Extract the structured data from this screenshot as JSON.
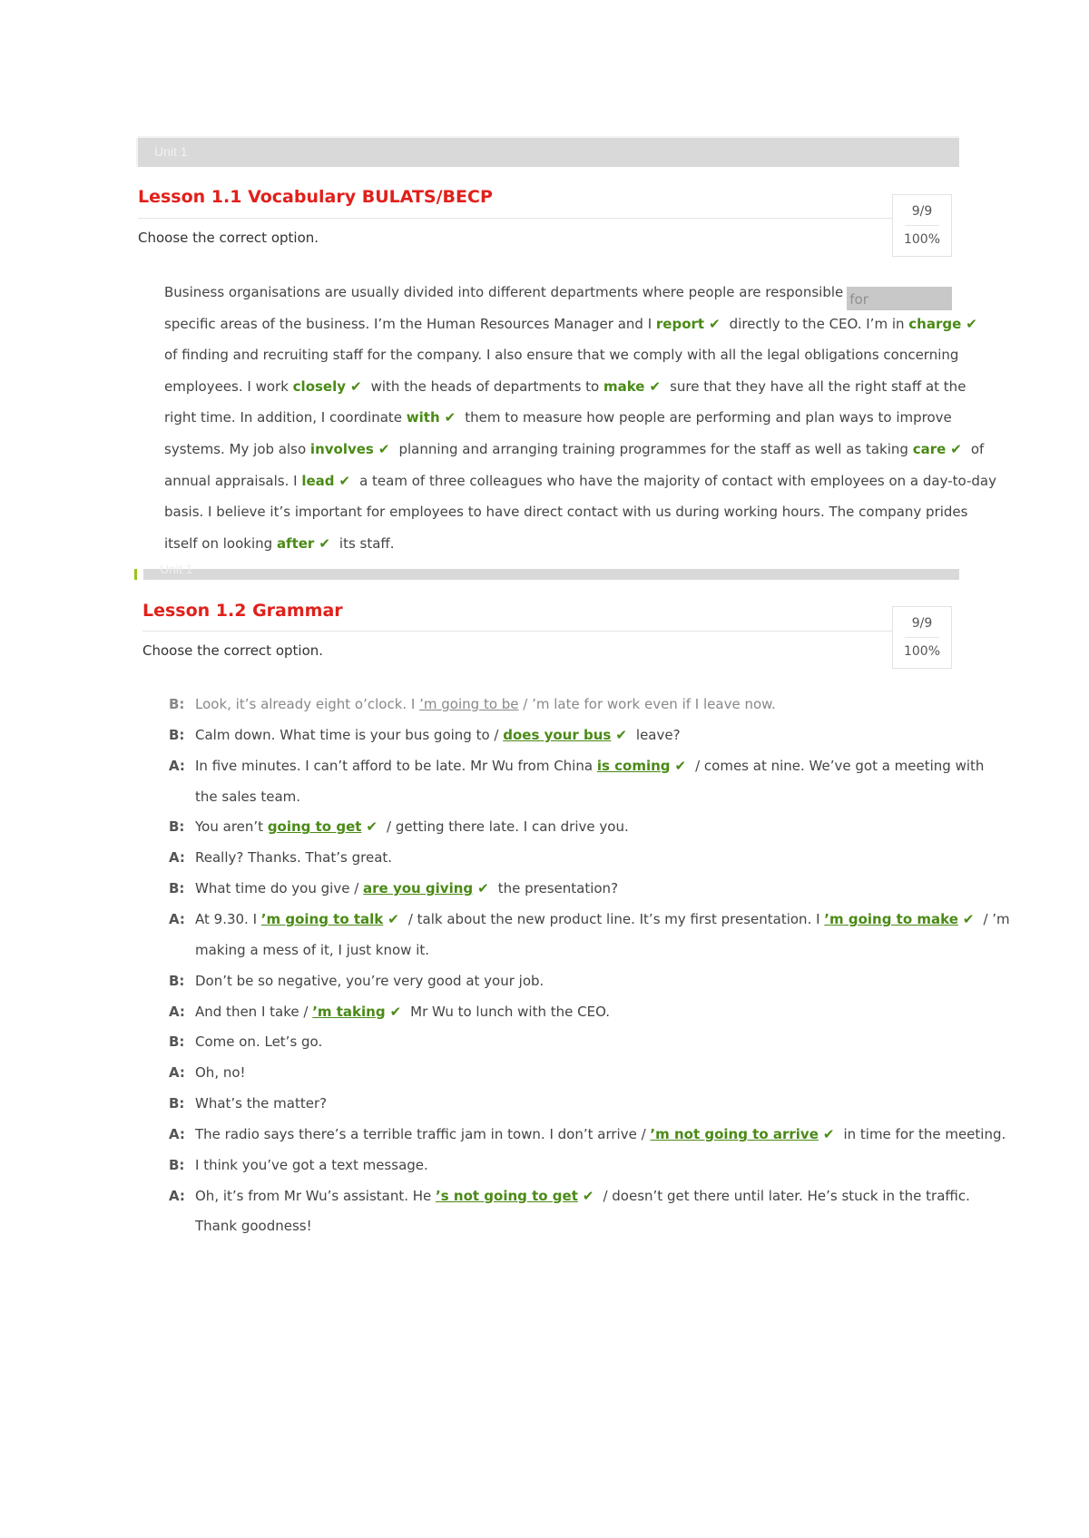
{
  "unit": {
    "label": "Unit 1"
  },
  "lessons": [
    {
      "title": "Lesson 1.1 Vocabulary BULATS/BECP",
      "instruction": "Choose the correct option.",
      "score": {
        "count": "9/9",
        "percent": "100%"
      },
      "gap_input": {
        "value": "for"
      },
      "lines": [
        {
          "parts": [
            "Business organisations are usually divided into different departments where people are responsible"
          ]
        },
        {
          "parts": [
            "specific areas of the business. I’m the Human Resources Manager and I ",
            {
              "answer": "report"
            },
            "directly to the CEO. I’m in ",
            {
              "answer": "charge"
            }
          ]
        },
        {
          "parts": [
            "of finding and recruiting staff for the company. I also ensure that we comply with all the legal obligations concerning"
          ]
        },
        {
          "parts": [
            "employees. I work ",
            {
              "answer": "closely"
            },
            "with the heads of departments to ",
            {
              "answer": "make"
            },
            "sure that they have all the right staff at the"
          ]
        },
        {
          "parts": [
            "right time. In addition, I coordinate ",
            {
              "answer": "with"
            },
            "them to measure how people are performing and plan ways to improve"
          ]
        },
        {
          "parts": [
            "systems. My job also ",
            {
              "answer": "involves"
            },
            "planning and arranging training programmes for the staff as well as taking ",
            {
              "answer": "care"
            },
            "of"
          ]
        },
        {
          "parts": [
            "annual appraisals. I ",
            {
              "answer": "lead"
            },
            "a team of three colleagues who have the majority of contact with employees on a day-to-day"
          ]
        },
        {
          "parts": [
            "basis. I believe it’s important for employees to have direct contact with us during working hours. The company prides"
          ]
        },
        {
          "parts": [
            "itself on looking ",
            {
              "answer": "after"
            },
            "its staff."
          ]
        }
      ]
    },
    {
      "title": "Lesson 1.2 Grammar",
      "instruction": "Choose the correct option.",
      "score": {
        "count": "9/9",
        "percent": "100%"
      },
      "dialogue": [
        {
          "speaker": "B:",
          "faded": true,
          "parts": [
            "Look, it’s already eight o’clock. I ",
            {
              "example": "’m going to be"
            },
            " / ’m late for work even if I leave now."
          ]
        },
        {
          "speaker": "B:",
          "parts": [
            "Calm down. What time is your bus going to / ",
            {
              "answer": "does your bus"
            },
            "leave?"
          ]
        },
        {
          "speaker": "A:",
          "parts": [
            "In five minutes. I can’t afford to be late. Mr Wu from China ",
            {
              "answer": "is coming"
            },
            "/ comes at nine. We’ve got a meeting with"
          ]
        },
        {
          "speaker": "",
          "parts": [
            "the sales team."
          ]
        },
        {
          "speaker": "B:",
          "parts": [
            "You aren’t ",
            {
              "answer": "going to get"
            },
            "/ getting there late. I can drive you."
          ]
        },
        {
          "speaker": "A:",
          "parts": [
            "Really? Thanks. That’s great."
          ]
        },
        {
          "speaker": "B:",
          "parts": [
            "What time do you give / ",
            {
              "answer": "are you giving"
            },
            "the presentation?"
          ]
        },
        {
          "speaker": "A:",
          "parts": [
            "At 9.30. I ",
            {
              "answer": "’m going to talk"
            },
            "/ talk about the new product line. It’s my first presentation. I ",
            {
              "answer": "’m going to make"
            },
            "/ ’m"
          ]
        },
        {
          "speaker": "",
          "parts": [
            "making a mess of it, I just know it."
          ]
        },
        {
          "speaker": "B:",
          "parts": [
            "Don’t be so negative, you’re very good at your job."
          ]
        },
        {
          "speaker": "A:",
          "parts": [
            "And then I take / ",
            {
              "answer": "’m taking"
            },
            "Mr Wu to lunch with the CEO."
          ]
        },
        {
          "speaker": "B:",
          "parts": [
            "Come on. Let’s go."
          ]
        },
        {
          "speaker": "A:",
          "parts": [
            "Oh, no!"
          ]
        },
        {
          "speaker": "B:",
          "parts": [
            "What’s the matter?"
          ]
        },
        {
          "speaker": "A:",
          "parts": [
            "The radio says there’s a terrible traffic jam in town. I don’t arrive / ",
            {
              "answer": "’m not going to arrive"
            },
            "in time for the meeting."
          ]
        },
        {
          "speaker": "B:",
          "parts": [
            "I think you’ve got a text message."
          ]
        },
        {
          "speaker": "A:",
          "parts": [
            "Oh, it’s from Mr Wu’s assistant. He ",
            {
              "answer": "’s not going to get"
            },
            "/ doesn’t get there until later. He’s stuck in the traffic."
          ]
        },
        {
          "speaker": "",
          "parts": [
            "Thank goodness!"
          ]
        }
      ]
    }
  ],
  "icons": {
    "check": "✔"
  },
  "colors": {
    "title_red": "#e0201b",
    "answer_green": "#4a8a16",
    "unit_bar": "#d9d9d9",
    "marker_green": "#9ac31c"
  }
}
